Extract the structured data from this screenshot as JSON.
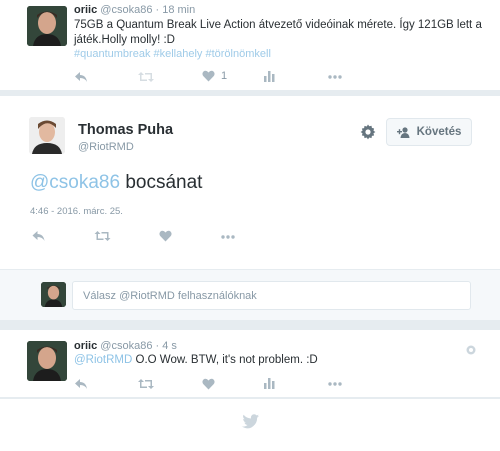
{
  "tweet1": {
    "name": "oriic",
    "handle": "@csoka86",
    "time": "· 18 min",
    "text": "75GB a Quantum Break Live Action átvezető videóinak mérete. Így 121GB lett a játék.Holly molly! :D",
    "hashtags": "#quantumbreak #kellahely #törölnömkell",
    "like_count": "1"
  },
  "main_tweet": {
    "name": "Thomas Puha",
    "handle": "@RiotRMD",
    "follow_label": "Követés",
    "mention": "@csoka86",
    "text": " bocsánat",
    "timestamp": "4:46 - 2016. márc. 25."
  },
  "reply_box": {
    "prefix": "Válasz ",
    "handle": "@RiotRMD",
    "suffix": " felhasználóknak"
  },
  "tweet3": {
    "name": "oriic",
    "handle": "@csoka86",
    "time": "· 4 s",
    "mention": "@RiotRMD",
    "text": " O.O Wow. BTW, it's not problem. :D"
  },
  "colors": {
    "link": "#8ec3e6",
    "muted": "#8899a6",
    "icon": "#aab8c2",
    "background": "#e6ecf0"
  },
  "icons": [
    "reply-icon",
    "retweet-icon",
    "like-icon",
    "analytics-icon",
    "more-icon",
    "gear-icon",
    "follow-user-icon",
    "info-icon",
    "twitter-bird-icon"
  ]
}
